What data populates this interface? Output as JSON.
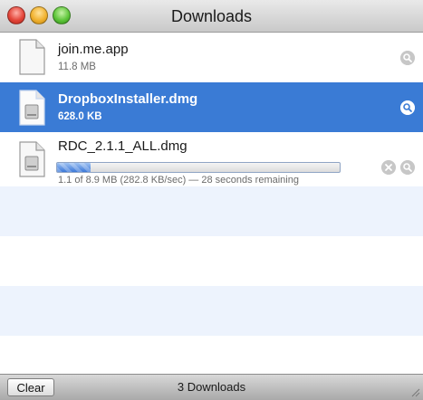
{
  "window": {
    "title": "Downloads"
  },
  "downloads": [
    {
      "name": "join.me.app",
      "detail": "11.8 MB",
      "state": "complete",
      "selected": false,
      "icon": "generic-document-icon"
    },
    {
      "name": "DropboxInstaller.dmg",
      "detail": "628.0 KB",
      "state": "complete",
      "selected": true,
      "icon": "disk-image-icon"
    },
    {
      "name": "RDC_2.1.1_ALL.dmg",
      "detail": "1.1 of 8.9 MB (282.8 KB/sec) — 28 seconds remaining",
      "state": "downloading",
      "progress": 0.12,
      "selected": false,
      "icon": "disk-image-icon"
    }
  ],
  "footer": {
    "clear_label": "Clear",
    "count_text": "3 Downloads"
  },
  "colors": {
    "selection": "#3a7bd5",
    "alternate_row": "#edf3fd"
  }
}
